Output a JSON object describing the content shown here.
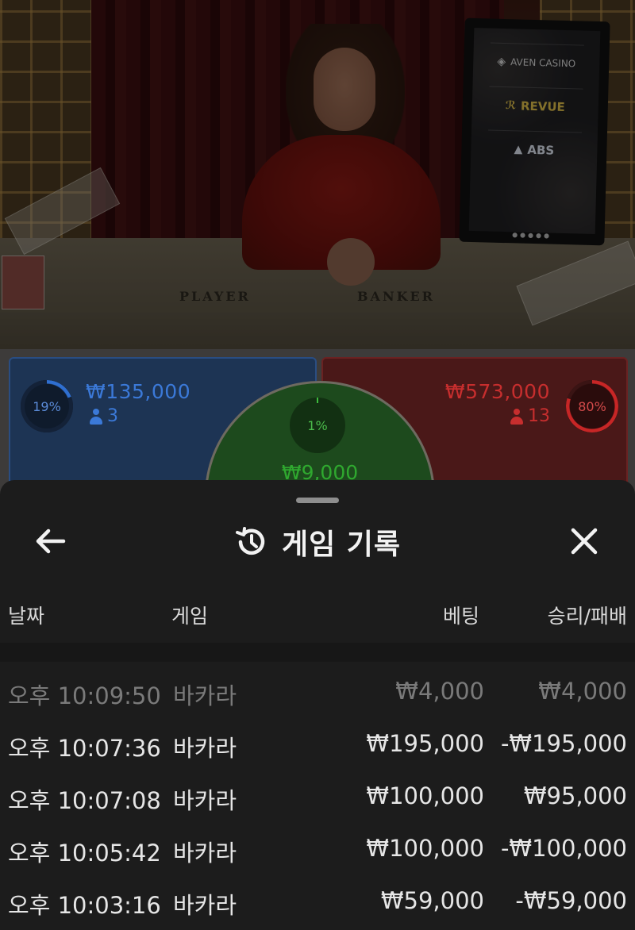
{
  "video": {
    "monitor_sponsors": [
      "AVEN CASINO",
      "REVUE",
      "ABS"
    ],
    "table_labels": {
      "player": "PLAYER",
      "banker": "BANKER"
    }
  },
  "bets": {
    "player": {
      "percent": "19%",
      "amount": "₩135,000",
      "players": "3",
      "color": "#2f6fd0",
      "fraction": 0.19
    },
    "tie": {
      "percent": "1%",
      "amount": "₩9,000",
      "color": "#2fa82f"
    },
    "banker": {
      "percent": "80%",
      "amount": "₩573,000",
      "players": "13",
      "color": "#c72626",
      "fraction": 0.8
    }
  },
  "sheet": {
    "title": "게임 기록",
    "icons": {
      "back": "arrow-left-icon",
      "history": "history-icon",
      "close": "close-icon"
    },
    "columns": {
      "date": "날짜",
      "game": "게임",
      "bet": "베팅",
      "result": "승리/패배"
    },
    "rows": [
      {
        "date": "오후 10:09:50",
        "game": "바카라",
        "bet": "₩4,000",
        "result": "₩4,000",
        "dim": true
      },
      {
        "date": "오후 10:07:36",
        "game": "바카라",
        "bet": "₩195,000",
        "result": "-₩195,000",
        "dim": false
      },
      {
        "date": "오후 10:07:08",
        "game": "바카라",
        "bet": "₩100,000",
        "result": "₩95,000",
        "dim": false
      },
      {
        "date": "오후 10:05:42",
        "game": "바카라",
        "bet": "₩100,000",
        "result": "-₩100,000",
        "dim": false
      },
      {
        "date": "오후 10:03:16",
        "game": "바카라",
        "bet": "₩59,000",
        "result": "-₩59,000",
        "dim": false
      }
    ]
  }
}
